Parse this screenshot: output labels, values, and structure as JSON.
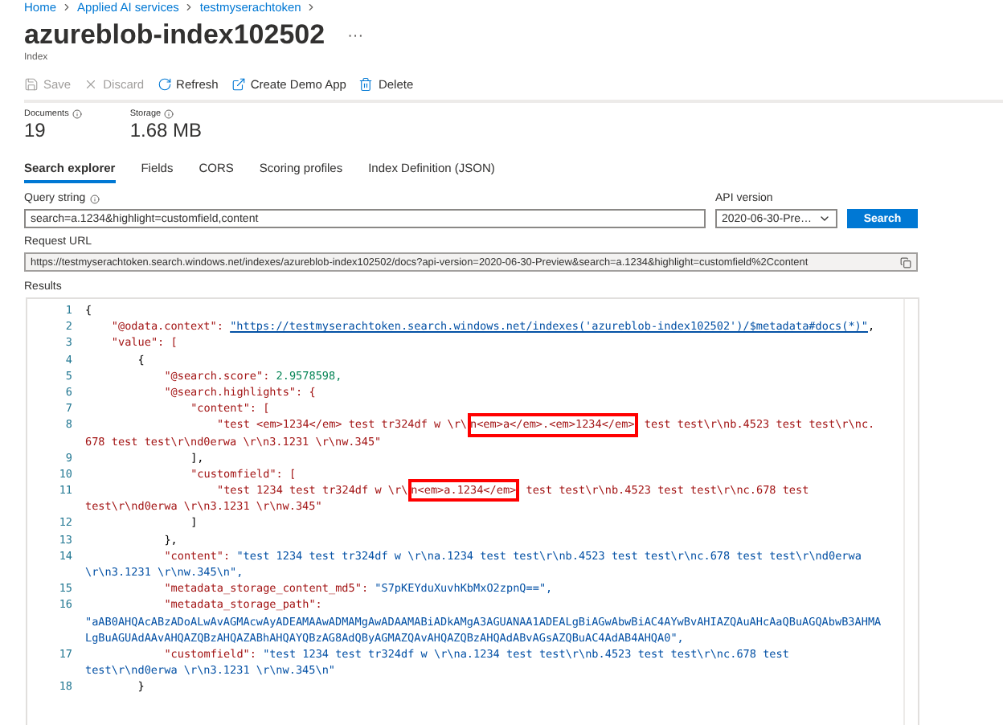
{
  "breadcrumb": [
    "Home",
    "Applied AI services",
    "testmyserachtoken"
  ],
  "title": "azureblob-index102502",
  "more": "···",
  "subtitle": "Index",
  "toolbar": [
    {
      "kind": "save",
      "label": "Save",
      "disabled": true
    },
    {
      "kind": "discard",
      "label": "Discard",
      "disabled": true
    },
    {
      "kind": "refresh",
      "label": "Refresh",
      "disabled": false
    },
    {
      "kind": "demo",
      "label": "Create Demo App",
      "disabled": false
    },
    {
      "kind": "delete",
      "label": "Delete",
      "disabled": false
    }
  ],
  "stats": [
    {
      "label": "Documents",
      "value": "19"
    },
    {
      "label": "Storage",
      "value": "1.68 MB"
    }
  ],
  "tabs": [
    {
      "label": "Search explorer",
      "selected": true
    },
    {
      "label": "Fields",
      "selected": false
    },
    {
      "label": "CORS",
      "selected": false
    },
    {
      "label": "Scoring profiles",
      "selected": false
    },
    {
      "label": "Index Definition (JSON)",
      "selected": false
    }
  ],
  "query": {
    "label": "Query string",
    "value": "search=a.1234&highlight=customfield,content"
  },
  "api_version": {
    "label": "API version",
    "value": "2020-06-30-Pre…"
  },
  "search_button": "Search",
  "request_url": {
    "label": "Request URL",
    "value": "https://testmyserachtoken.search.windows.net/indexes/azureblob-index102502/docs?api-version=2020-06-30-Preview&search=a.1234&highlight=customfield%2Ccontent"
  },
  "results": {
    "label": "Results",
    "lines": [
      {
        "number": "1",
        "rows": [
          {
            "tokens": [
              {
                "kind": "punct",
                "text": "{"
              }
            ]
          }
        ]
      },
      {
        "number": "2",
        "rows": [
          {
            "tokens": [
              {
                "kind": "key",
                "text": "\"@odata.context\": "
              },
              {
                "kind": "link",
                "text": "\"https://testmyserachtoken.search.windows.net/indexes('azureblob-index102502')/$metadata#docs(*)\""
              },
              {
                "kind": "punct",
                "text": ","
              }
            ]
          }
        ]
      },
      {
        "number": "3",
        "rows": [
          {
            "tokens": [
              {
                "kind": "key",
                "text": "\"value\": ["
              }
            ]
          }
        ]
      },
      {
        "number": "4",
        "rows": [
          {
            "tokens": [
              {
                "kind": "punct",
                "text": "{"
              }
            ]
          }
        ]
      },
      {
        "number": "5",
        "rows": [
          {
            "tokens": [
              {
                "kind": "key",
                "text": "\"@search.score\": "
              },
              {
                "kind": "number",
                "text": "2.9578598,"
              }
            ]
          }
        ]
      },
      {
        "number": "6",
        "rows": [
          {
            "tokens": [
              {
                "kind": "key",
                "text": "\"@search.highlights\": {"
              }
            ]
          }
        ]
      },
      {
        "number": "7",
        "rows": [
          {
            "tokens": [
              {
                "kind": "key",
                "text": "\"content\": ["
              }
            ]
          }
        ]
      },
      {
        "number": "8",
        "rows": [
          {
            "tokens": [
              {
                "kind": "item",
                "text": "\"test <em>1234</em> test tr324df w \\r\\"
              },
              {
                "kind": "item",
                "text": "n<em>a</em>.<em>1234</em>",
                "highlighted": true
              },
              {
                "kind": "item",
                "text": " test test\\r\\nb.4523 test test\\r\\nc."
              }
            ]
          },
          {
            "tokens": [
              {
                "kind": "item",
                "text": "678 test test\\r\\nd0erwa \\r\\n3.1231 \\r\\nw.345\""
              }
            ]
          }
        ]
      },
      {
        "number": "9",
        "rows": [
          {
            "tokens": [
              {
                "kind": "punct",
                "text": "],"
              }
            ]
          }
        ]
      },
      {
        "number": "10",
        "rows": [
          {
            "tokens": [
              {
                "kind": "key",
                "text": "\"customfield\": ["
              }
            ]
          }
        ]
      },
      {
        "number": "11",
        "rows": [
          {
            "tokens": [
              {
                "kind": "item",
                "text": "\"test 1234 test tr324df w \\r\\"
              },
              {
                "kind": "item",
                "text": "n<em>a.1234</em>",
                "highlighted": true
              },
              {
                "kind": "item",
                "text": " test test\\r\\nb.4523 test test\\r\\nc.678 test"
              }
            ]
          },
          {
            "tokens": [
              {
                "kind": "item",
                "text": "test\\r\\nd0erwa \\r\\n3.1231 \\r\\nw.345\""
              }
            ]
          }
        ]
      },
      {
        "number": "12",
        "rows": [
          {
            "tokens": [
              {
                "kind": "punct",
                "text": "]"
              }
            ]
          }
        ]
      },
      {
        "number": "13",
        "rows": [
          {
            "tokens": [
              {
                "kind": "punct",
                "text": "},"
              }
            ]
          }
        ]
      },
      {
        "number": "14",
        "rows": [
          {
            "tokens": [
              {
                "kind": "key",
                "text": "\"content\": "
              },
              {
                "kind": "string",
                "text": "\"test 1234 test tr324df w \\r\\na.1234 test test\\r\\nb.4523 test test\\r\\nc.678 test test\\r\\nd0erwa"
              }
            ]
          },
          {
            "tokens": [
              {
                "kind": "string",
                "text": "\\r\\n3.1231 \\r\\nw.345\\n\","
              }
            ]
          }
        ]
      },
      {
        "number": "15",
        "rows": [
          {
            "tokens": [
              {
                "kind": "key",
                "text": "\"metadata_storage_content_md5\": "
              },
              {
                "kind": "string",
                "text": "\"S7pKEYduXuvhKbMxO2zpnQ==\","
              }
            ]
          }
        ]
      },
      {
        "number": "16",
        "rows": [
          {
            "tokens": [
              {
                "kind": "key",
                "text": "\"metadata_storage_path\":"
              }
            ]
          },
          {
            "tokens": [
              {
                "kind": "string",
                "text": "\"aAB0AHQAcABzADoALwAvAGMAcwAyADEAMAAwADMAMgAwADAAMABiADkAMgA3AGUANAA1ADEALgBiAGwAbwBiAC4AYwBvAHIAZQAuAHcAaQBuAGQAbwB3AHMA"
              }
            ]
          },
          {
            "tokens": [
              {
                "kind": "string",
                "text": "LgBuAGUAdAAvAHQAZQBzAHQAZABhAHQAYQBzAG8AdQByAGMAZQAvAHQAZQBzAHQAdABvAGsAZQBuAC4AdAB4AHQA0\","
              }
            ]
          }
        ]
      },
      {
        "number": "17",
        "rows": [
          {
            "tokens": [
              {
                "kind": "key",
                "text": "\"customfield\": "
              },
              {
                "kind": "string",
                "text": "\"test 1234 test tr324df w \\r\\na.1234 test test\\r\\nb.4523 test test\\r\\nc.678 test"
              }
            ]
          },
          {
            "tokens": [
              {
                "kind": "string",
                "text": "test\\r\\nd0erwa \\r\\n3.1231 \\r\\nw.345\\n\""
              }
            ]
          }
        ]
      },
      {
        "number": "18",
        "rows": [
          {
            "tokens": [
              {
                "kind": "punct",
                "text": "}"
              }
            ]
          }
        ]
      }
    ]
  }
}
